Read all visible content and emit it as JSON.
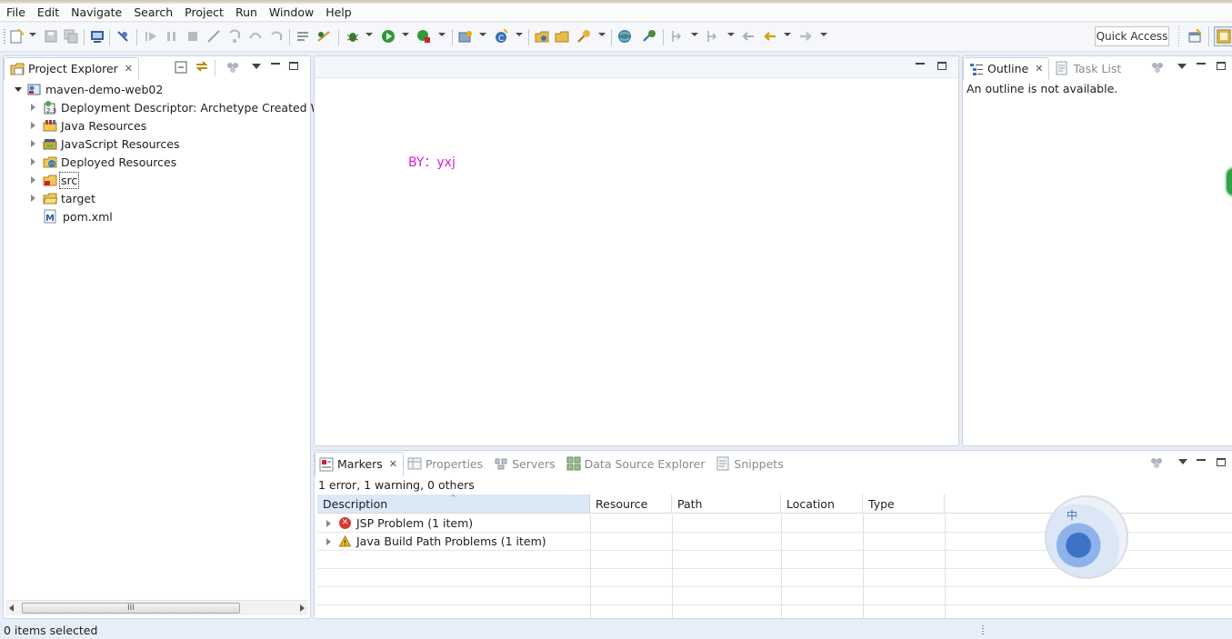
{
  "menu": [
    "File",
    "Edit",
    "Navigate",
    "Search",
    "Project",
    "Run",
    "Window",
    "Help"
  ],
  "toolbar": {
    "quick_access": "Quick Access"
  },
  "project_explorer": {
    "tab_label": "Project Explorer",
    "project": "maven-demo-web02",
    "items": [
      {
        "label": "Deployment Descriptor: Archetype Created We",
        "icon": "deployment-descriptor-icon"
      },
      {
        "label": "Java Resources",
        "icon": "java-resources-icon"
      },
      {
        "label": "JavaScript Resources",
        "icon": "javascript-resources-icon"
      },
      {
        "label": "Deployed Resources",
        "icon": "deployed-resources-icon"
      },
      {
        "label": "src",
        "icon": "src-folder-icon"
      },
      {
        "label": "target",
        "icon": "folder-icon"
      },
      {
        "label": "pom.xml",
        "icon": "maven-file-icon"
      }
    ],
    "scroll_thumb": "III"
  },
  "editor": {
    "watermark": "BY：yxj"
  },
  "outline": {
    "tab_label": "Outline",
    "inactive_tab": "Task List",
    "message": "An outline is not available."
  },
  "markers": {
    "tabs": [
      {
        "label": "Markers",
        "active": true
      },
      {
        "label": "Properties",
        "active": false
      },
      {
        "label": "Servers",
        "active": false
      },
      {
        "label": "Data Source Explorer",
        "active": false
      },
      {
        "label": "Snippets",
        "active": false
      }
    ],
    "summary": "1 error, 1 warning, 0 others",
    "columns": [
      "Description",
      "Resource",
      "Path",
      "Location",
      "Type"
    ],
    "rows": [
      {
        "description": "JSP Problem (1 item)",
        "severity": "error"
      },
      {
        "description": "Java Build Path Problems (1 item)",
        "severity": "warning"
      }
    ]
  },
  "ime_badge": "中",
  "status": {
    "text": "0 items selected"
  },
  "colors": {
    "watermark": "#d61ed6",
    "error": "#d9382f",
    "warning": "#e8b418",
    "selected_header": "#dbe9f7"
  }
}
